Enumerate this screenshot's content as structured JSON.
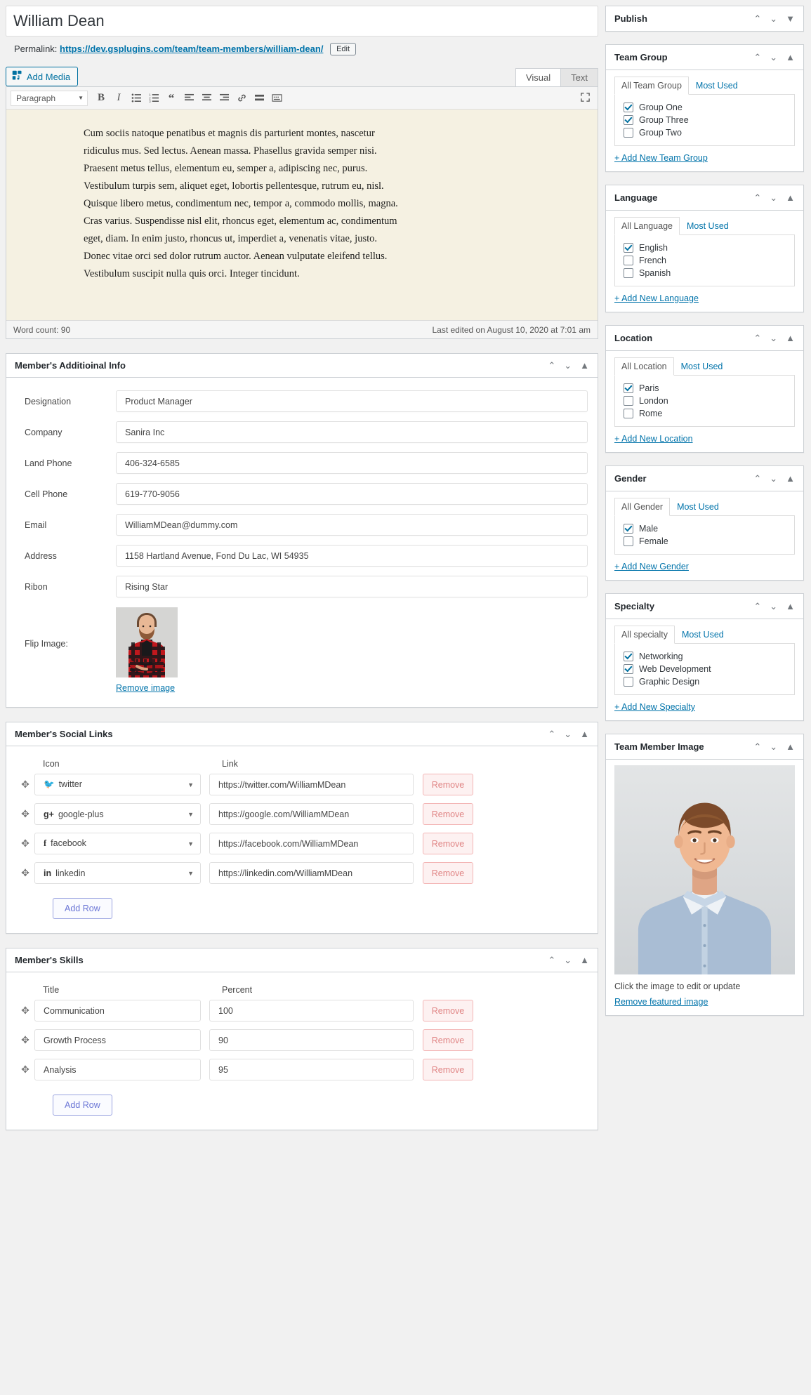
{
  "post": {
    "title": "William Dean",
    "permalink_label": "Permalink:",
    "permalink_url": "https://dev.gsplugins.com/team/team-members/william-dean/",
    "edit_button": "Edit"
  },
  "editor": {
    "add_media": "Add Media",
    "tab_visual": "Visual",
    "tab_text": "Text",
    "format_select": "Paragraph",
    "toolbar_icons": [
      "bold-icon",
      "italic-icon",
      "bulleted-list-icon",
      "numbered-list-icon",
      "blockquote-icon",
      "align-left-icon",
      "align-center-icon",
      "align-right-icon",
      "insert-link-icon",
      "read-more-icon",
      "toolbar-toggle-icon"
    ],
    "fullscreen_icon": "fullscreen-icon",
    "content": "Cum sociis natoque penatibus et magnis dis parturient montes, nascetur ridiculus mus. Sed lectus. Aenean massa. Phasellus gravida semper nisi. Praesent metus tellus, elementum eu, semper a, adipiscing nec, purus. Vestibulum turpis sem, aliquet eget, lobortis pellentesque, rutrum eu, nisl. Quisque libero metus, condimentum nec, tempor a, commodo mollis, magna. Cras varius. Suspendisse nisl elit, rhoncus eget, elementum ac, condimentum eget, diam. In enim justo, rhoncus ut, imperdiet a, venenatis vitae, justo. Donec vitae orci sed dolor rutrum auctor. Aenean vulputate eleifend tellus. Vestibulum suscipit nulla quis orci. Integer tincidunt.",
    "word_count": "Word count: 90",
    "last_edited": "Last edited on August 10, 2020 at 7:01 am"
  },
  "additional_info": {
    "title": "Member's Additioinal Info",
    "fields": [
      {
        "label": "Designation",
        "value": "Product Manager"
      },
      {
        "label": "Company",
        "value": "Sanira Inc"
      },
      {
        "label": "Land Phone",
        "value": "406-324-6585"
      },
      {
        "label": "Cell Phone",
        "value": "619-770-9056"
      },
      {
        "label": "Email",
        "value": "WilliamMDean@dummy.com"
      },
      {
        "label": "Address",
        "value": "1158 Hartland Avenue, Fond Du Lac, WI 54935"
      },
      {
        "label": "Ribon",
        "value": "Rising Star"
      }
    ],
    "flip_image_label": "Flip Image:",
    "remove_image": "Remove image"
  },
  "social_links": {
    "title": "Member's Social Links",
    "col_icon": "Icon",
    "col_link": "Link",
    "rows": [
      {
        "icon": "twitter-icon",
        "glyph": "𝑫",
        "name": "twitter",
        "link": "https://twitter.com/WilliamMDean",
        "remove": "Remove"
      },
      {
        "icon": "google-plus-icon",
        "glyph": "g+",
        "name": "google-plus",
        "link": "https://google.com/WilliamMDean",
        "remove": "Remove"
      },
      {
        "icon": "facebook-icon",
        "glyph": "f",
        "name": "facebook",
        "link": "https://facebook.com/WilliamMDean",
        "remove": "Remove"
      },
      {
        "icon": "linkedin-icon",
        "glyph": "in",
        "name": "linkedin",
        "link": "https://linkedin.com/WilliamMDean",
        "remove": "Remove"
      }
    ],
    "add_row": "Add Row"
  },
  "skills": {
    "title": "Member's Skills",
    "col_title": "Title",
    "col_percent": "Percent",
    "rows": [
      {
        "title": "Communication",
        "percent": "100",
        "remove": "Remove"
      },
      {
        "title": "Growth Process",
        "percent": "90",
        "remove": "Remove"
      },
      {
        "title": "Analysis",
        "percent": "95",
        "remove": "Remove"
      }
    ],
    "add_row": "Add Row"
  },
  "sidebar": {
    "publish": {
      "title": "Publish"
    },
    "taxonomies": [
      {
        "title": "Team Group",
        "tab_all": "All Team Group",
        "tab_most": "Most Used",
        "items": [
          {
            "label": "Group One",
            "checked": true
          },
          {
            "label": "Group Three",
            "checked": true
          },
          {
            "label": "Group Two",
            "checked": false
          }
        ],
        "add_new": "+ Add New Team Group"
      },
      {
        "title": "Language",
        "tab_all": "All Language",
        "tab_most": "Most Used",
        "items": [
          {
            "label": "English",
            "checked": true
          },
          {
            "label": "French",
            "checked": false
          },
          {
            "label": "Spanish",
            "checked": false
          }
        ],
        "add_new": "+ Add New Language"
      },
      {
        "title": "Location",
        "tab_all": "All Location",
        "tab_most": "Most Used",
        "items": [
          {
            "label": "Paris",
            "checked": true
          },
          {
            "label": "London",
            "checked": false
          },
          {
            "label": "Rome",
            "checked": false
          }
        ],
        "add_new": "+ Add New Location"
      },
      {
        "title": "Gender",
        "tab_all": "All Gender",
        "tab_most": "Most Used",
        "items": [
          {
            "label": "Male",
            "checked": true
          },
          {
            "label": "Female",
            "checked": false
          }
        ],
        "add_new": "+ Add New Gender"
      },
      {
        "title": "Specialty",
        "tab_all": "All specialty",
        "tab_most": "Most Used",
        "items": [
          {
            "label": "Networking",
            "checked": true
          },
          {
            "label": "Web Development",
            "checked": true
          },
          {
            "label": "Graphic Design",
            "checked": false
          }
        ],
        "add_new": "+ Add New Specialty"
      }
    ],
    "featured": {
      "title": "Team Member Image",
      "note": "Click the image to edit or update",
      "remove": "Remove featured image"
    }
  },
  "colors": {
    "link": "#0073aa",
    "accent": "#6b76d6",
    "danger": "#e08585",
    "editor_bg": "#f5f1e2"
  }
}
